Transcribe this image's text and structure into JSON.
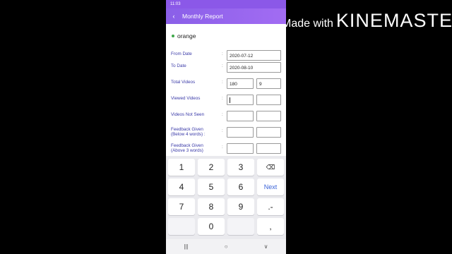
{
  "watermark": {
    "prefix": "Made with",
    "brand": "KINEMASTER"
  },
  "status_bar": {
    "time": "11:03"
  },
  "app_bar": {
    "back_icon": "back-arrow-icon",
    "title": "Monthly Report"
  },
  "profile": {
    "name": "orange",
    "status_color": "#3fa84a"
  },
  "form": {
    "from_date": {
      "label": "From Date",
      "value": "2020-07-12"
    },
    "to_date": {
      "label": "To Date",
      "value": "2020-08-10"
    },
    "total_videos": {
      "label": "Total Videos",
      "value1": "180",
      "value2": "9"
    },
    "viewed_videos": {
      "label": "Viewed Videos",
      "value1": "",
      "value2": ""
    },
    "videos_not_seen": {
      "label": "Videos Not Seen",
      "value1": "",
      "value2": ""
    },
    "feedback_below": {
      "label": "Feedback Given\n(Below 4 words) :",
      "value1": "",
      "value2": ""
    },
    "feedback_above": {
      "label": "Feedback Given\n(Above 3 words)",
      "value1": "",
      "value2": ""
    },
    "colon": ":"
  },
  "keyboard": {
    "k1": "1",
    "k2": "2",
    "k3": "3",
    "backspace": "⌫",
    "k4": "4",
    "k5": "5",
    "k6": "6",
    "next": "Next",
    "k7": "7",
    "k8": "8",
    "k9": "9",
    "dot": ".-",
    "k0": "0",
    "period": ","
  },
  "nav_bar": {
    "recents": "|||",
    "home": "○",
    "back": "∨"
  },
  "colors": {
    "accent": "#8b58e8",
    "label_text": "#3a3aa8",
    "next_key": "#3a63d8"
  }
}
